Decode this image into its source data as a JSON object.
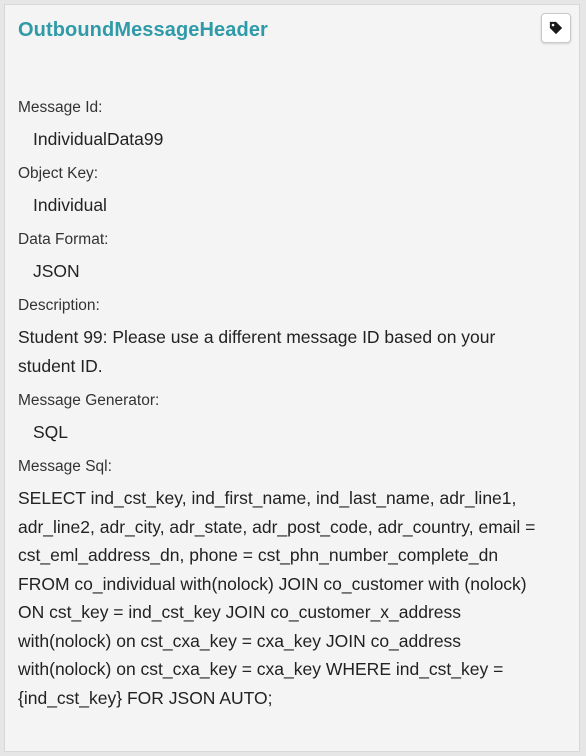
{
  "panel": {
    "title": "OutboundMessageHeader",
    "tag_icon": "tag-icon"
  },
  "fields": [
    {
      "label": "Message Id:",
      "value": "IndividualData99"
    },
    {
      "label": "Object Key:",
      "value": "Individual"
    },
    {
      "label": "Data Format:",
      "value": "JSON"
    },
    {
      "label": "Description:",
      "value": "Student 99: Please use a different message ID based on your student ID."
    },
    {
      "label": "Message Generator:",
      "value": "SQL"
    },
    {
      "label": "Message Sql:",
      "value": "SELECT ind_cst_key, ind_first_name, ind_last_name, adr_line1, adr_line2, adr_city, adr_state, adr_post_code, adr_country, email = cst_eml_address_dn, phone = cst_phn_number_complete_dn FROM co_individual with(nolock) JOIN co_customer with (nolock) ON cst_key = ind_cst_key JOIN co_customer_x_address with(nolock) on cst_cxa_key = cxa_key JOIN co_address with(nolock) on cst_cxa_key = cxa_key WHERE ind_cst_key = {ind_cst_key} FOR JSON AUTO;"
    }
  ]
}
